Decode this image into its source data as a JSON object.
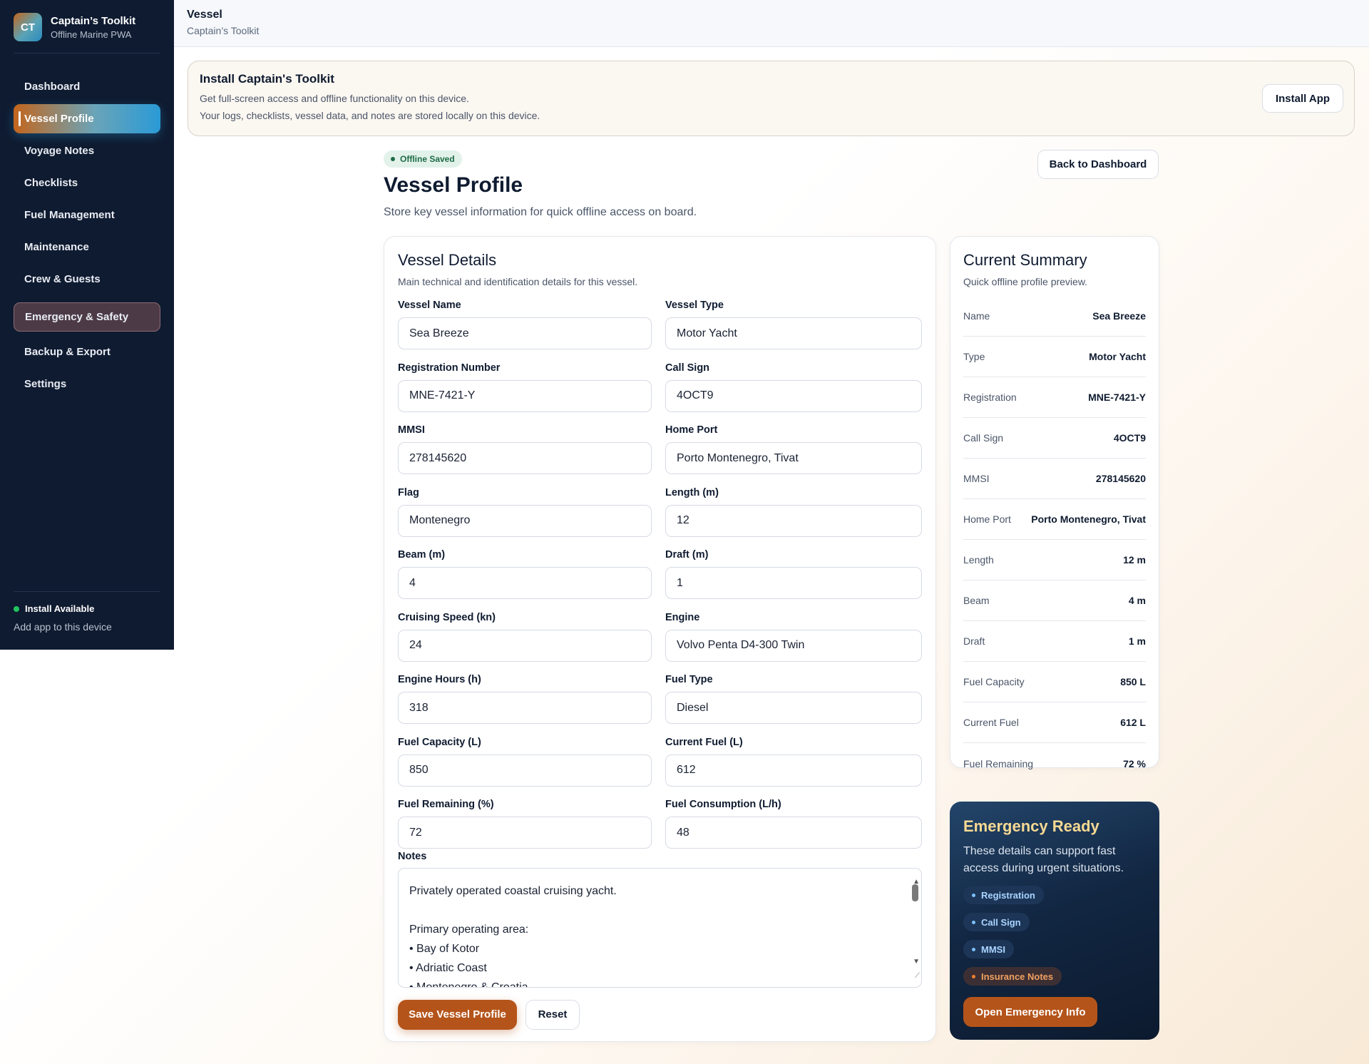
{
  "sidebar": {
    "brand": {
      "logo": "CT",
      "title": "Captain’s Toolkit",
      "subtitle": "Offline Marine PWA"
    },
    "items": [
      {
        "label": "Dashboard"
      },
      {
        "label": "Vessel Profile"
      },
      {
        "label": "Voyage Notes"
      },
      {
        "label": "Checklists"
      },
      {
        "label": "Fuel Management"
      },
      {
        "label": "Maintenance"
      },
      {
        "label": "Crew & Guests"
      },
      {
        "label": "Emergency & Safety"
      },
      {
        "label": "Backup & Export"
      },
      {
        "label": "Settings"
      }
    ],
    "footer": {
      "status": "Install Available",
      "sub": "Add app to this device"
    }
  },
  "header": {
    "title": "Vessel",
    "subtitle": "Captain’s Toolkit"
  },
  "banner": {
    "title": "Install Captain's Toolkit",
    "line1": "Get full-screen access and offline functionality on this device.",
    "line2": "Your logs, checklists, vessel data, and notes are stored locally on this device.",
    "button": "Install App"
  },
  "page": {
    "badge": "Offline Saved",
    "title": "Vessel Profile",
    "subtitle": "Store key vessel information for quick offline access on board.",
    "back_button": "Back to Dashboard"
  },
  "details": {
    "title": "Vessel Details",
    "subtitle": "Main technical and identification details for this vessel.",
    "fields": [
      {
        "label": "Vessel Name",
        "value": "Sea Breeze"
      },
      {
        "label": "Vessel Type",
        "value": "Motor Yacht"
      },
      {
        "label": "Registration Number",
        "value": "MNE-7421-Y"
      },
      {
        "label": "Call Sign",
        "value": "4OCT9"
      },
      {
        "label": "MMSI",
        "value": "278145620"
      },
      {
        "label": "Home Port",
        "value": "Porto Montenegro, Tivat"
      },
      {
        "label": "Flag",
        "value": "Montenegro"
      },
      {
        "label": "Length (m)",
        "value": "12"
      },
      {
        "label": "Beam (m)",
        "value": "4"
      },
      {
        "label": "Draft (m)",
        "value": "1"
      },
      {
        "label": "Cruising Speed (kn)",
        "value": "24"
      },
      {
        "label": "Engine",
        "value": "Volvo Penta D4-300 Twin"
      },
      {
        "label": "Engine Hours (h)",
        "value": "318"
      },
      {
        "label": "Fuel Type",
        "value": "Diesel"
      },
      {
        "label": "Fuel Capacity (L)",
        "value": "850"
      },
      {
        "label": "Current Fuel (L)",
        "value": "612"
      },
      {
        "label": "Fuel Remaining (%)",
        "value": "72"
      },
      {
        "label": "Fuel Consumption (L/h)",
        "value": "48"
      }
    ],
    "notes_label": "Notes",
    "notes_lines": [
      "Privately operated coastal cruising yacht.",
      "",
      "Primary operating area:",
      "• Bay of Kotor",
      "• Adriatic Coast",
      "• Montenegro & Croatia"
    ],
    "save_button": "Save Vessel Profile",
    "reset_button": "Reset"
  },
  "summary": {
    "title": "Current Summary",
    "subtitle": "Quick offline profile preview.",
    "rows": [
      {
        "key": "Name",
        "value": "Sea Breeze"
      },
      {
        "key": "Type",
        "value": "Motor Yacht"
      },
      {
        "key": "Registration",
        "value": "MNE-7421-Y"
      },
      {
        "key": "Call Sign",
        "value": "4OCT9"
      },
      {
        "key": "MMSI",
        "value": "278145620"
      },
      {
        "key": "Home Port",
        "value": "Porto Montenegro, Tivat"
      },
      {
        "key": "Length",
        "value": "12 m"
      },
      {
        "key": "Beam",
        "value": "4 m"
      },
      {
        "key": "Draft",
        "value": "1 m"
      },
      {
        "key": "Fuel Capacity",
        "value": "850 L"
      },
      {
        "key": "Current Fuel",
        "value": "612 L"
      },
      {
        "key": "Fuel Remaining",
        "value": "72 %"
      }
    ]
  },
  "emergency": {
    "title": "Emergency Ready",
    "text": "These details can support fast access during urgent situations.",
    "chips": [
      "Registration",
      "Call Sign",
      "MMSI",
      "Insurance Notes"
    ],
    "button": "Open Emergency Info"
  },
  "colors": {
    "accent": "#b5541a",
    "sidebar_bg": "#0f1b30",
    "badge_green": "#1d6b45",
    "emergency_title": "#f7d992"
  }
}
